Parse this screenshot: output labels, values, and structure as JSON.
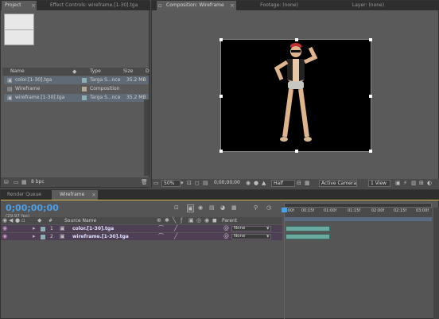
{
  "project_panel": {
    "tabs": [
      {
        "label": "Project"
      },
      {
        "label": "Effect Controls: wireframe.[1-30].tga"
      }
    ],
    "columns": {
      "name": "Name",
      "type": "Type",
      "size": "Size",
      "extra": "D"
    },
    "items": [
      {
        "name": "color.[1-30].tga",
        "type": "Targa S...nce",
        "size": "35.2 MB",
        "label_color": "#8ab0b0"
      },
      {
        "name": "Wireframe",
        "type": "Composition",
        "size": "",
        "label_color": "#b7a996"
      },
      {
        "name": "wireframe.[1-30].tga",
        "type": "Targa S...nce",
        "size": "35.2 MB",
        "label_color": "#8ab0b0"
      }
    ],
    "bpc": "8 bpc"
  },
  "comp_panel": {
    "tabs": [
      {
        "label": "Composition: Wireframe"
      },
      {
        "label": "Footage: (none)"
      },
      {
        "label": "Layer: (none)"
      }
    ],
    "zoom": "50%",
    "timecode": "0;00;00;00",
    "resolution": "Half",
    "camera": "Active Camera",
    "view": "1 View"
  },
  "timeline_panel": {
    "tabs": [
      {
        "label": "Render Queue"
      },
      {
        "label": "Wireframe"
      }
    ],
    "timecode": "0;00;00;00",
    "fps": "(29.97 fps)",
    "columns": {
      "num": "#",
      "source": "Source Name",
      "parent": "Parent"
    },
    "ruler_labels": [
      "0:00f",
      "00:15f",
      "01:00f",
      "01:15f",
      "02:00f",
      "02:15f",
      "03:00f"
    ],
    "layers": [
      {
        "num": "1",
        "name": "color.[1-30].tga",
        "parent": "None"
      },
      {
        "num": "2",
        "name": "wireframe.[1-30].tga",
        "parent": "None"
      }
    ]
  },
  "colors": {
    "accent_blue": "#4aa0e8",
    "playhead_red": "#e03030",
    "layer_bar": "#6aa8a0"
  }
}
